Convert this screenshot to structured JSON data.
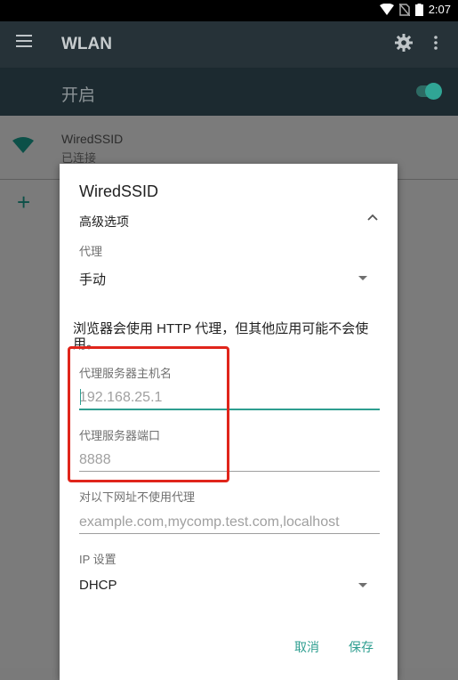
{
  "status_bar": {
    "time": "2:07"
  },
  "app_bar": {
    "title": "WLAN"
  },
  "master_switch": {
    "label": "开启",
    "on": true
  },
  "network": {
    "name": "WiredSSID",
    "status": "已连接"
  },
  "dialog": {
    "title": "WiredSSID",
    "advanced_options_label": "高级选项",
    "proxy": {
      "label": "代理",
      "value": "手动"
    },
    "warning": "浏览器会使用 HTTP 代理，但其他应用可能不会使用。",
    "hostname": {
      "label": "代理服务器主机名",
      "placeholder": "192.168.25.1"
    },
    "port": {
      "label": "代理服务器端口",
      "placeholder": "8888"
    },
    "bypass": {
      "label": "对以下网址不使用代理",
      "placeholder": "example.com,mycomp.test.com,localhost"
    },
    "ip_settings": {
      "label": "IP 设置",
      "value": "DHCP"
    },
    "cancel_label": "取消",
    "save_label": "保存"
  },
  "colors": {
    "accent": "#2e9e90",
    "appbar": "#263238",
    "highlight": "#e0251b"
  }
}
